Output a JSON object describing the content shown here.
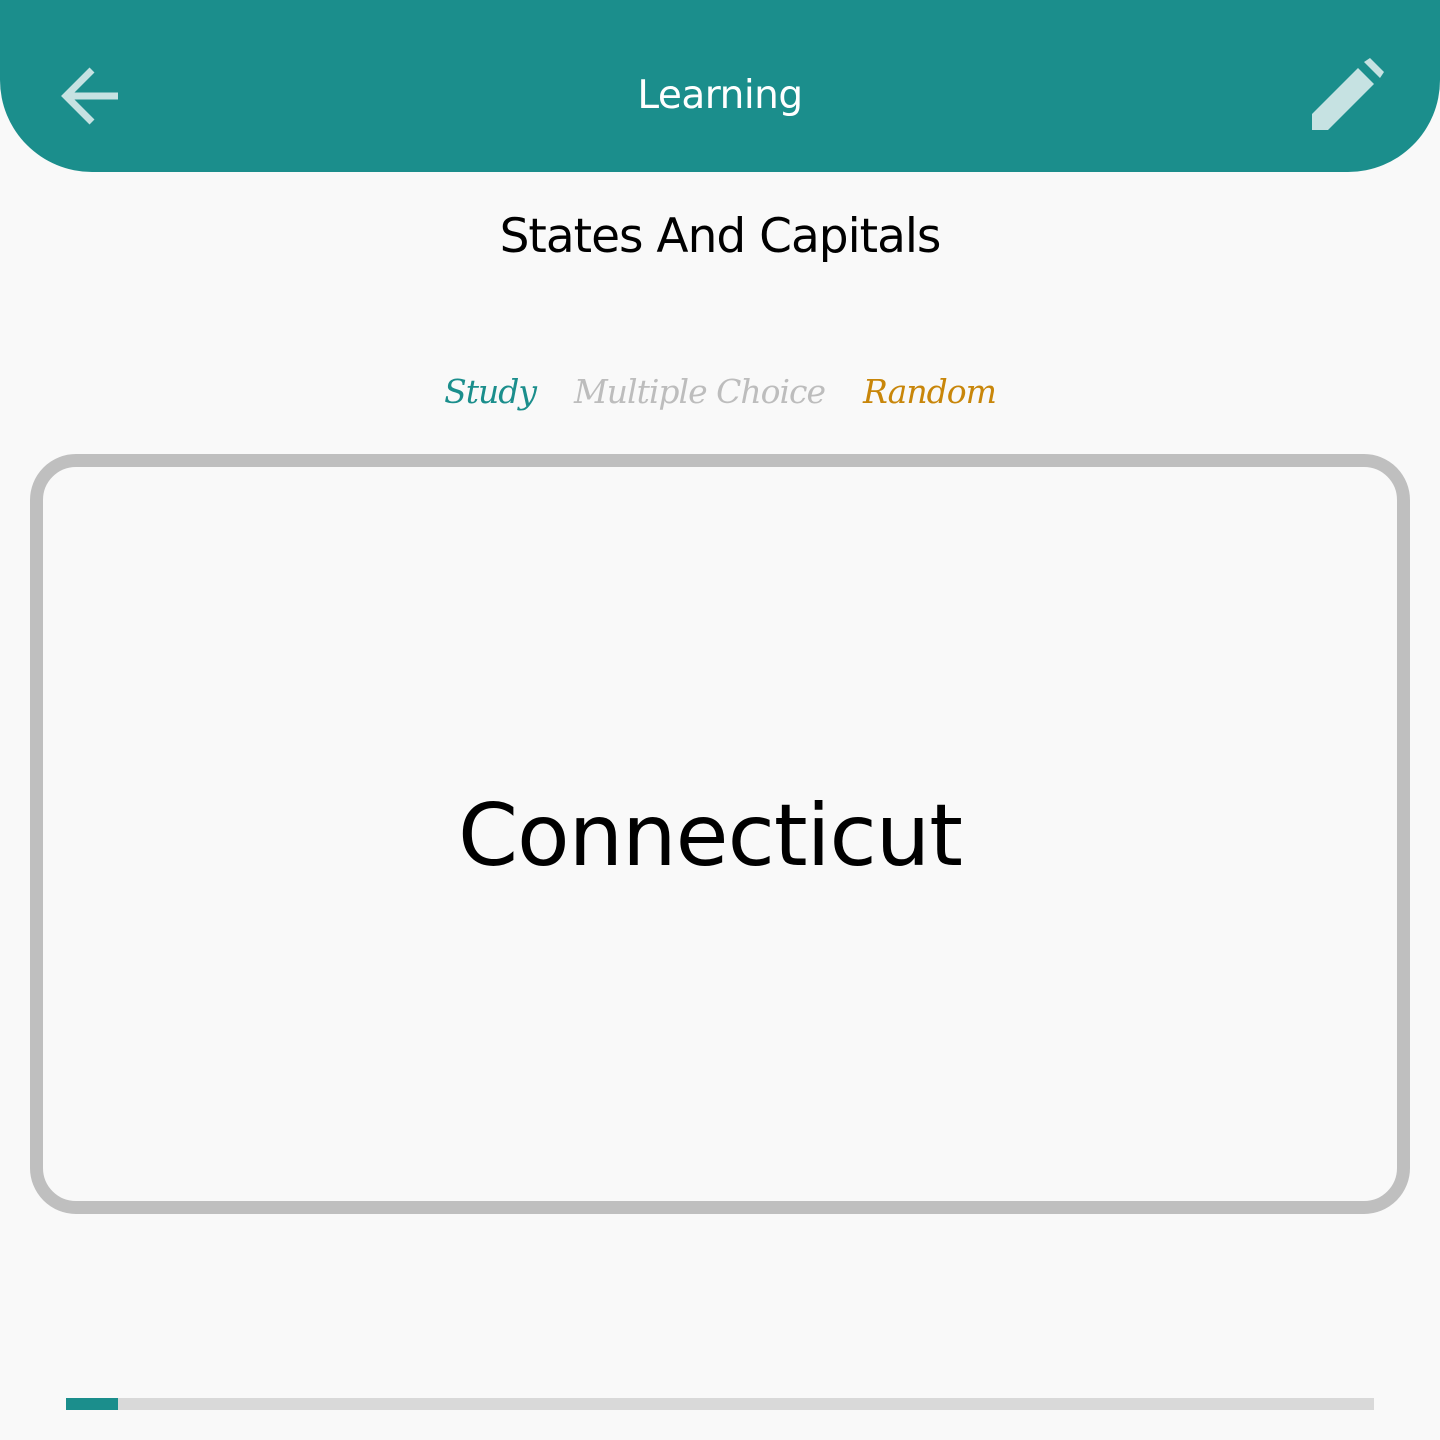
{
  "app_bar": {
    "title": "Learning",
    "back_icon": "arrow-left-icon",
    "edit_icon": "pencil-icon",
    "color": "#1b8e8c"
  },
  "deck": {
    "title": "States And Capitals"
  },
  "modes": [
    {
      "label": "Study",
      "color": "#1b8e8c"
    },
    {
      "label": "Multiple Choice",
      "color": "#bdbdbd"
    },
    {
      "label": "Random",
      "color": "#c8860a"
    }
  ],
  "card": {
    "text": "Connecticut"
  },
  "progress": {
    "fraction": 0.04,
    "fill_color": "#1b8e8c",
    "track_color": "#d9d9d9"
  }
}
